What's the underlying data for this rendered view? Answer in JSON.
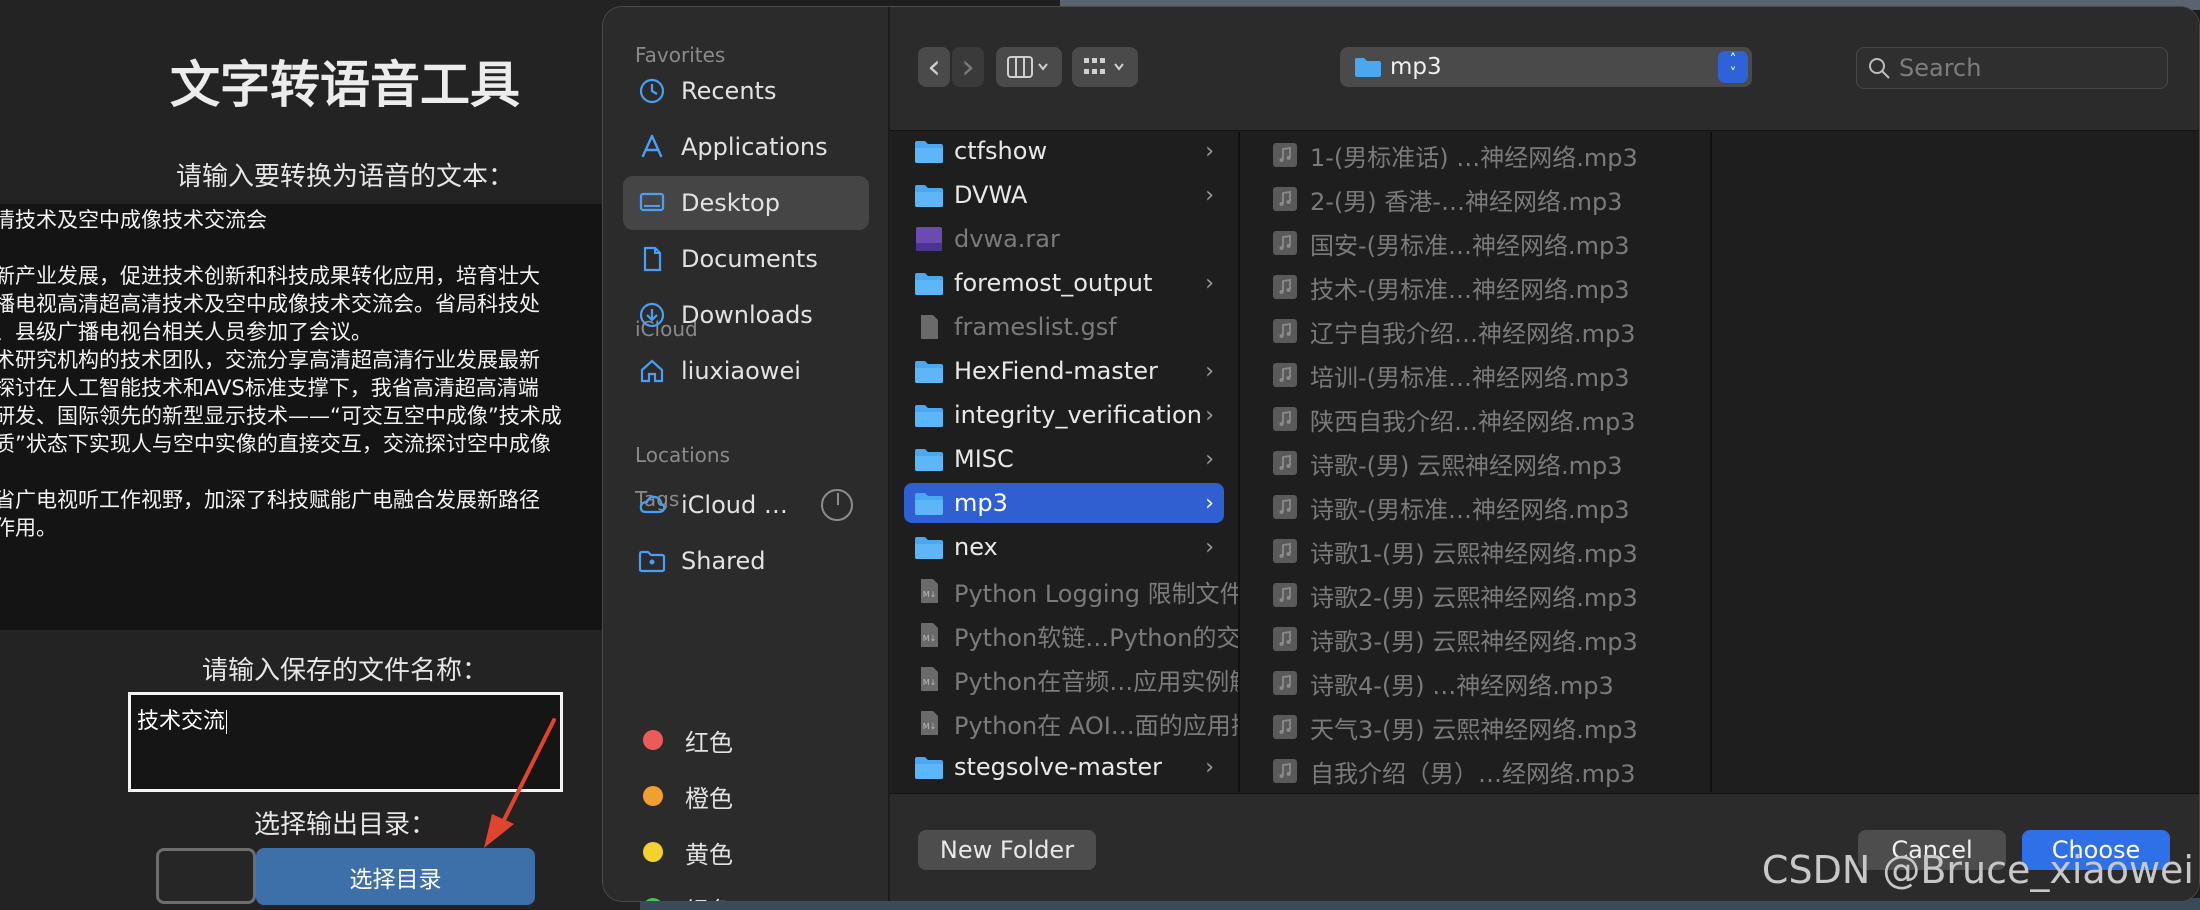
{
  "app": {
    "title": "文字转语音工具",
    "text_label": "请输入要转换为语音的文本：",
    "text_lines": [
      "清技术及空中成像技术交流会",
      "",
      "新产业发展，促进技术创新和科技成果转化应用，培育壮大",
      "播电视高清超高清技术及空中成像技术交流会。省局科技处",
      "、县级广播电视台相关人员参加了会议。",
      "术研究机构的技术团队，交流分享高清超高清行业发展最新",
      "探讨在人工智能技术和AVS标准支撑下，我省高清超高清端",
      "研发、国际领先的新型显示技术——“可交互空中成像”技术成",
      "质”状态下实现人与空中实像的直接交互，交流探讨空中成像",
      "",
      "省广电视听工作视野，加深了科技赋能广电融合发展新路径",
      "作用。"
    ],
    "file_label": "请输入保存的文件名称：",
    "file_value": "技术交流",
    "dir_label": "选择输出目录：",
    "dir_button": "选择目录"
  },
  "dialog": {
    "sidebar": {
      "favorites_header": "Favorites",
      "favorites": [
        {
          "label": "Recents",
          "icon": "clock-icon"
        },
        {
          "label": "Applications",
          "icon": "applications-icon"
        },
        {
          "label": "Desktop",
          "icon": "desktop-icon",
          "active": true
        },
        {
          "label": "Documents",
          "icon": "document-icon"
        },
        {
          "label": "Downloads",
          "icon": "download-icon"
        },
        {
          "label": "liuxiaowei",
          "icon": "home-icon"
        }
      ],
      "icloud_header": "iCloud",
      "icloud": [
        {
          "label": "iCloud …",
          "icon": "cloud-icon"
        },
        {
          "label": "Shared",
          "icon": "shared-folder-icon"
        }
      ],
      "locations_header": "Locations",
      "tags_header": "Tags",
      "tags": [
        {
          "label": "红色",
          "color": "#ec5a5a"
        },
        {
          "label": "橙色",
          "color": "#f0a030"
        },
        {
          "label": "黄色",
          "color": "#f4d22e"
        },
        {
          "label": "绿色",
          "color": "#46c45a"
        }
      ]
    },
    "toolbar": {
      "back": "‹",
      "forward": "›",
      "path_name": "mp3",
      "search_placeholder": "Search"
    },
    "column1": [
      {
        "name": "ctfshow",
        "kind": "folder",
        "chevron": true
      },
      {
        "name": "DVWA",
        "kind": "folder",
        "chevron": true
      },
      {
        "name": "dvwa.rar",
        "kind": "rar",
        "dim": true
      },
      {
        "name": "foremost_output",
        "kind": "folder",
        "chevron": true
      },
      {
        "name": "frameslist.gsf",
        "kind": "file",
        "dim": true
      },
      {
        "name": "HexFiend-master",
        "kind": "folder",
        "chevron": true
      },
      {
        "name": "integrity_verification",
        "kind": "folder",
        "chevron": true
      },
      {
        "name": "MISC",
        "kind": "folder",
        "chevron": true
      },
      {
        "name": "mp3",
        "kind": "folder",
        "chevron": true,
        "selected": true
      },
      {
        "name": "nex",
        "kind": "folder",
        "chevron": true
      },
      {
        "name": "Python Logging 限制文件大小",
        "kind": "md",
        "dim": true
      },
      {
        "name": "Python软链…Python的交互",
        "kind": "md",
        "dim": true
      },
      {
        "name": "Python在音频…应用实例解析",
        "kind": "md",
        "dim": true
      },
      {
        "name": "Python在 AOI…面的应用探讨",
        "kind": "md",
        "dim": true
      },
      {
        "name": "stegsolve-master",
        "kind": "folder",
        "chevron": true
      }
    ],
    "column2": [
      "1-(男标准话) …神经网络.mp3",
      "2-(男) 香港-…神经网络.mp3",
      "国安-(男标准…神经网络.mp3",
      "技术-(男标准…神经网络.mp3",
      "辽宁自我介绍…神经网络.mp3",
      "培训-(男标准…神经网络.mp3",
      "陕西自我介绍…神经网络.mp3",
      "诗歌-(男) 云熙神经网络.mp3",
      "诗歌-(男标准…神经网络.mp3",
      "诗歌1-(男) 云熙神经网络.mp3",
      "诗歌2-(男) 云熙神经网络.mp3",
      "诗歌3-(男) 云熙神经网络.mp3",
      "诗歌4-(男) …神经网络.mp3",
      "天气3-(男) 云熙神经网络.mp3",
      "自我介绍（男）…经网络.mp3"
    ],
    "footer": {
      "new_folder": "New Folder",
      "cancel": "Cancel",
      "choose": "Choose"
    }
  },
  "watermark": "CSDN @Bruce_xiaowei",
  "colors": {
    "accent": "#2f5fd0",
    "folder": "#4aa8f0",
    "app_button": "#3d6fa8",
    "arrow": "#e0442e"
  }
}
